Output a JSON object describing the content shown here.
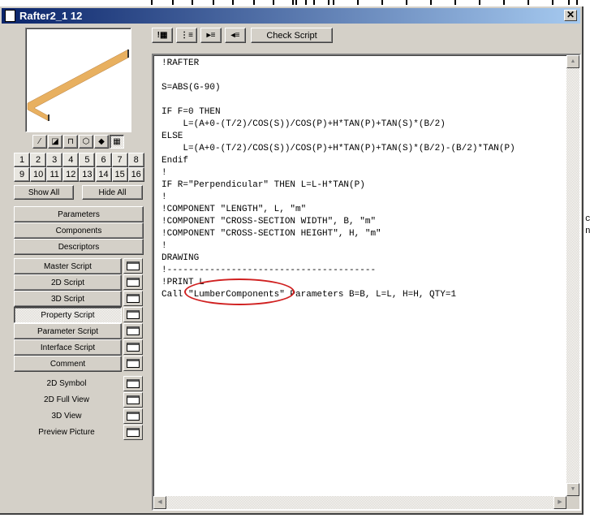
{
  "window": {
    "title": "Rafter2_1 12"
  },
  "toolbar": {
    "icons": [
      "insert-comment-icon",
      "line-numbers-icon",
      "indent-icon",
      "outdent-icon"
    ],
    "check_script": "Check Script"
  },
  "view_icons": [
    "plan-view-icon",
    "section-icon",
    "elevation-icon",
    "axonometric-icon",
    "shaded-3d-icon",
    "filmstrip-icon"
  ],
  "layers": [
    "1",
    "2",
    "3",
    "4",
    "5",
    "6",
    "7",
    "8",
    "9",
    "10",
    "11",
    "12",
    "13",
    "14",
    "15",
    "16"
  ],
  "show_all": "Show All",
  "hide_all": "Hide All",
  "sections": [
    "Parameters",
    "Components",
    "Descriptors"
  ],
  "scripts": [
    "Master Script",
    "2D Script",
    "3D Script",
    "Property Script",
    "Parameter Script",
    "Interface Script",
    "Comment"
  ],
  "active_script": "Property Script",
  "views": [
    "2D Symbol",
    "2D Full View",
    "3D View",
    "Preview Picture"
  ],
  "code": [
    "!RAFTER",
    "",
    "S=ABS(G-90)",
    "",
    "IF F=0 THEN",
    "    L=(A+0-(T/2)/COS(S))/COS(P)+H*TAN(P)+TAN(S)*(B/2)",
    "ELSE",
    "    L=(A+0-(T/2)/COS(S))/COS(P)+H*TAN(P)+TAN(S)*(B/2)-(B/2)*TAN(P)",
    "Endif",
    "!",
    "IF R=\"Perpendicular\" THEN L=L-H*TAN(P)",
    "!",
    "!COMPONENT \"LENGTH\", L, \"m\"",
    "!COMPONENT \"CROSS-SECTION WIDTH\", B, \"m\"",
    "!COMPONENT \"CROSS-SECTION HEIGHT\", H, \"m\"",
    "!",
    "DRAWING",
    "!---------------------------------------",
    "!PRINT L",
    "Call \"LumberComponents\" Parameters B=B, L=L, H=H, QTY=1"
  ],
  "highlight_color": "#d02020",
  "background_text": [
    "c",
    "n"
  ]
}
